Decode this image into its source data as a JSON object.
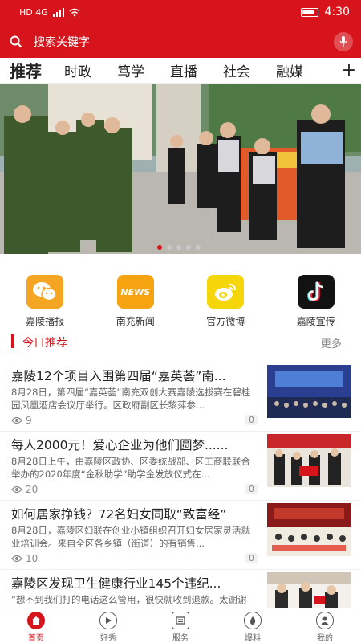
{
  "status_bar": {
    "left": "HD 4G",
    "time": "4:30"
  },
  "search": {
    "placeholder": "搜索关键字"
  },
  "tabs": [
    {
      "label": "推荐",
      "active": true
    },
    {
      "label": "时政"
    },
    {
      "label": "笃学"
    },
    {
      "label": "直播"
    },
    {
      "label": "社会"
    },
    {
      "label": "融媒"
    }
  ],
  "tab_plus": "+",
  "banner": {
    "slide_count": 5,
    "active_slide": 1
  },
  "apps": [
    {
      "label": "嘉陵播报",
      "icon": "wechat-icon",
      "color": "#f4a623"
    },
    {
      "label": "南充新闻",
      "icon": "news-icon",
      "color": "#f6a312",
      "icon_text": "NEWS"
    },
    {
      "label": "官方微博",
      "icon": "weibo-icon",
      "color": "#f5d60b"
    },
    {
      "label": "嘉陵宣传",
      "icon": "tiktok-icon",
      "color": "#121212"
    }
  ],
  "section": {
    "title": "今日推荐",
    "more": "更多"
  },
  "news": [
    {
      "title": "嘉陵12个项目入围第四届“嘉英荟”南...",
      "desc": "8月28日，第四届“嘉英荟”南充双创大赛嘉陵选拔赛在碧桂园凤凰酒店会议厅举行。区政府副区长黎萍参...",
      "views": "9",
      "comments": "0"
    },
    {
      "title": "每人2000元！爱心企业为他们圆梦......",
      "desc": "8月28日上午，由嘉陵区政协、区委统战部、区工商联联合举办的2020年度“金秋助学”助学金发放仪式在...",
      "views": "20",
      "comments": "0"
    },
    {
      "title": "如何居家挣钱？72名妇女同取“致富经”",
      "desc": "8月28日，嘉陵区妇联在创业小镇组织召开妇女居家灵活就业培训会。来自全区各乡镇（街道）的有销售...",
      "views": "10",
      "comments": "0"
    },
    {
      "title": "嘉陵区发现卫生健康行业145个违纪...",
      "desc": "“想不到我们打的电话这么管用，很快就收到退款。太谢谢了，你们开展的这个治理，让老百姓看病心里更...",
      "views": "",
      "comments": ""
    }
  ],
  "bottom_nav": [
    {
      "label": "首页",
      "icon": "home-icon",
      "active": true
    },
    {
      "label": "好秀",
      "icon": "play-icon"
    },
    {
      "label": "服务",
      "icon": "service-icon"
    },
    {
      "label": "爆料",
      "icon": "fire-icon"
    },
    {
      "label": "我的",
      "icon": "profile-icon"
    }
  ],
  "colors": {
    "brand": "#d7141c"
  }
}
